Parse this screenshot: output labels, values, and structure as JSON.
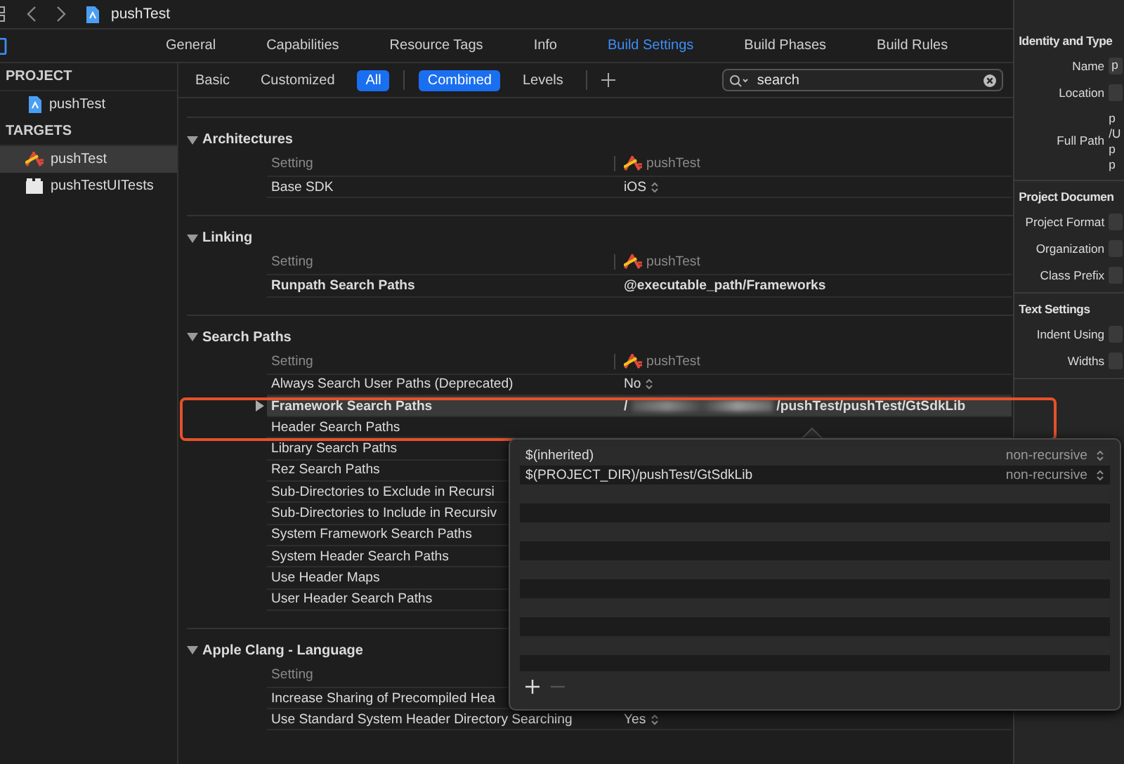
{
  "navbar": {
    "title": "pushTest"
  },
  "tabs": [
    {
      "label": "General",
      "selected": false
    },
    {
      "label": "Capabilities",
      "selected": false
    },
    {
      "label": "Resource Tags",
      "selected": false
    },
    {
      "label": "Info",
      "selected": false
    },
    {
      "label": "Build Settings",
      "selected": true
    },
    {
      "label": "Build Phases",
      "selected": false
    },
    {
      "label": "Build Rules",
      "selected": false
    }
  ],
  "sidebar": {
    "sections": [
      {
        "title": "PROJECT",
        "items": [
          {
            "label": "pushTest",
            "kind": "project",
            "selected": false
          }
        ]
      },
      {
        "title": "TARGETS",
        "items": [
          {
            "label": "pushTest",
            "kind": "app",
            "selected": true
          },
          {
            "label": "pushTestUITests",
            "kind": "tests",
            "selected": false
          }
        ]
      }
    ]
  },
  "filters": {
    "scope": [
      {
        "label": "Basic",
        "selected": false
      },
      {
        "label": "Customized",
        "selected": false
      },
      {
        "label": "All",
        "selected": true
      }
    ],
    "view": [
      {
        "label": "Combined",
        "selected": true
      },
      {
        "label": "Levels",
        "selected": false
      }
    ],
    "search": {
      "value": "search"
    }
  },
  "sections": [
    {
      "title": "Architectures",
      "expanded": true,
      "header": {
        "setting": "Setting",
        "target": "pushTest"
      },
      "rows": [
        {
          "name": "Base SDK",
          "value": "iOS",
          "popup": true,
          "bold": false,
          "selected": false
        }
      ]
    },
    {
      "title": "Linking",
      "expanded": true,
      "header": {
        "setting": "Setting",
        "target": "pushTest"
      },
      "rows": [
        {
          "name": "Runpath Search Paths",
          "value": "@executable_path/Frameworks",
          "popup": false,
          "bold": true,
          "selected": false
        }
      ]
    },
    {
      "title": "Search Paths",
      "expanded": true,
      "header": {
        "setting": "Setting",
        "target": "pushTest"
      },
      "rows": [
        {
          "name": "Always Search User Paths (Deprecated)",
          "value": "No",
          "popup": true,
          "bold": false,
          "selected": false
        },
        {
          "name": "Framework Search Paths",
          "value_prefix": "/",
          "redacted": true,
          "value": "/pushTest/pushTest/GtSdkLib",
          "popup": false,
          "bold": true,
          "selected": true,
          "expandable": true
        },
        {
          "name": "Header Search Paths",
          "popup": false,
          "bold": false,
          "selected": false
        },
        {
          "name": "Library Search Paths",
          "popup": false,
          "bold": false,
          "selected": false
        },
        {
          "name": "Rez Search Paths",
          "popup": false,
          "bold": false,
          "selected": false
        },
        {
          "name": "Sub-Directories to Exclude in Recursi",
          "popup": false,
          "bold": false,
          "selected": false
        },
        {
          "name": "Sub-Directories to Include in Recursiv",
          "popup": false,
          "bold": false,
          "selected": false
        },
        {
          "name": "System Framework Search Paths",
          "popup": false,
          "bold": false,
          "selected": false
        },
        {
          "name": "System Header Search Paths",
          "popup": false,
          "bold": false,
          "selected": false
        },
        {
          "name": "Use Header Maps",
          "popup": false,
          "bold": false,
          "selected": false
        },
        {
          "name": "User Header Search Paths",
          "popup": false,
          "bold": false,
          "selected": false
        }
      ]
    },
    {
      "title": "Apple Clang - Language",
      "expanded": true,
      "header": {
        "setting": "Setting"
      },
      "rows": [
        {
          "name": "Increase Sharing of Precompiled Hea",
          "popup": false,
          "bold": false,
          "selected": false
        },
        {
          "name": "Use Standard System Header Directory Searching",
          "value": "Yes",
          "popup": true,
          "bold": false,
          "selected": false
        }
      ]
    }
  ],
  "path_list": {
    "items": [
      {
        "path": "$(inherited)",
        "mode": "non-recursive"
      },
      {
        "path": "$(PROJECT_DIR)/pushTest/GtSdkLib",
        "mode": "non-recursive"
      }
    ]
  },
  "inspector": {
    "sections": [
      {
        "title": "Identity and Type",
        "fields": [
          {
            "label": "Name",
            "kind": "field",
            "value": "p"
          },
          {
            "label": "Location",
            "kind": "popup"
          },
          {
            "label": "Full Path",
            "kind": "text",
            "lines": [
              "p",
              "/U",
              "p",
              "p"
            ]
          }
        ]
      },
      {
        "title": "Project Documen",
        "fields": [
          {
            "label": "Project Format",
            "kind": "popup"
          },
          {
            "label": "Organization",
            "kind": "field"
          },
          {
            "label": "Class Prefix",
            "kind": "field"
          }
        ]
      },
      {
        "title": "Text Settings",
        "fields": [
          {
            "label": "Indent Using",
            "kind": "popup"
          },
          {
            "label": "Widths",
            "kind": "field"
          }
        ]
      }
    ]
  }
}
